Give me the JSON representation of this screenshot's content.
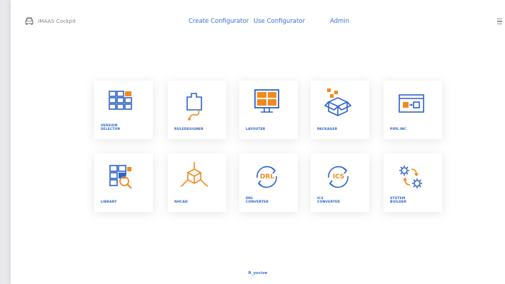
{
  "app": {
    "brand_label": "IMAAS Cockpit"
  },
  "nav": {
    "items": [
      {
        "label": "Create Configurator"
      },
      {
        "label": "Use Configurator"
      },
      {
        "label": "Admin"
      }
    ]
  },
  "tiles": [
    {
      "label": "VERSION\nSELECTOR",
      "icon": "version-selector-icon"
    },
    {
      "label": "RULEDESIGNER",
      "icon": "rule-designer-icon"
    },
    {
      "label": "LAYOUTER",
      "icon": "layouter-icon"
    },
    {
      "label": "PACKAGER",
      "icon": "packager-icon"
    },
    {
      "label": "PIPE.INC",
      "icon": "pipe-inc-icon"
    },
    {
      "label": "LIBRARY",
      "icon": "library-icon"
    },
    {
      "label": "NHCAD",
      "icon": "nhcad-icon"
    },
    {
      "label": "DRL\nCONVERTER",
      "icon": "drl-converter-icon",
      "badge": "DRL"
    },
    {
      "label": "ICS\nCONVERTER",
      "icon": "ics-converter-icon",
      "badge": "ICS"
    },
    {
      "label": "SYSTEM\nBUILDER",
      "icon": "system-builder-icon"
    }
  ],
  "footer": {
    "text": "R_yocive"
  },
  "colors": {
    "blue": "#2d62c8",
    "orange": "#f28a1e"
  }
}
